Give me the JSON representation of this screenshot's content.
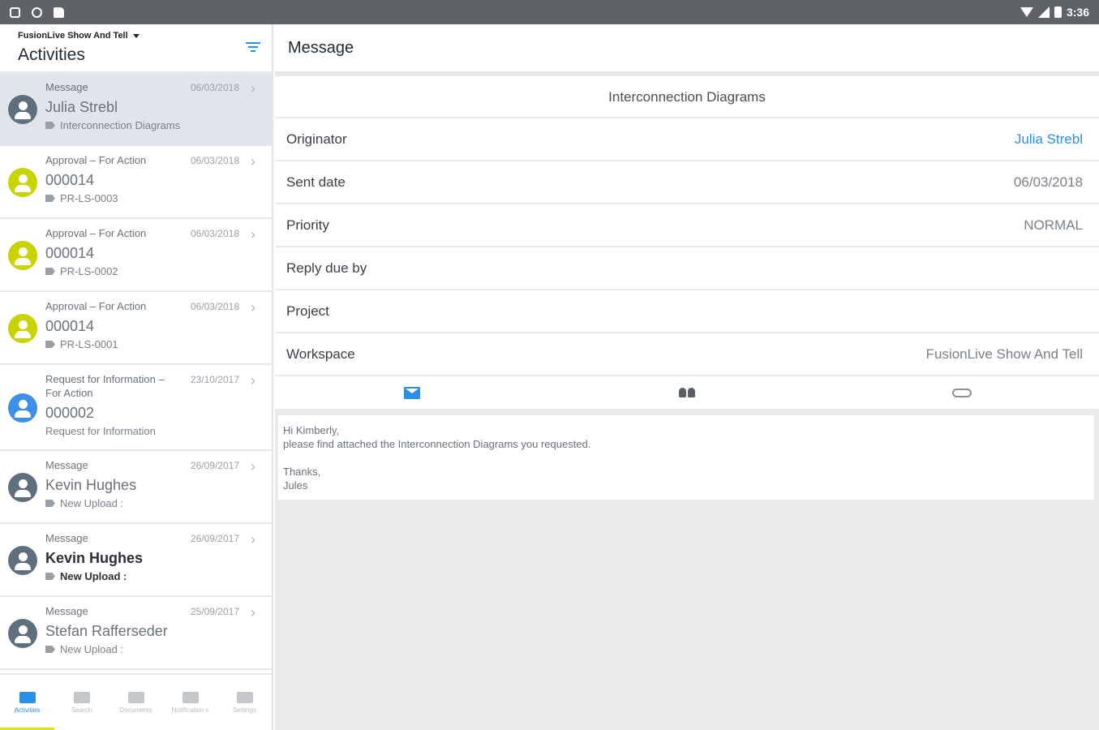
{
  "statusbar": {
    "time": "3:36"
  },
  "left": {
    "workspace": "FusionLive Show And Tell",
    "title": "Activities",
    "items": [
      {
        "type": "Message",
        "date": "06/03/2018",
        "title": "Julia Strebl",
        "sub": "Interconnection Diagrams",
        "avatar_color": "#5f6f7e",
        "selected": true,
        "bold": false
      },
      {
        "type": "Approval – For Action",
        "date": "06/03/2018",
        "title": "000014",
        "sub": "PR-LS-0003",
        "avatar_color": "#c8d400",
        "selected": false,
        "bold": false
      },
      {
        "type": "Approval – For Action",
        "date": "06/03/2018",
        "title": "000014",
        "sub": "PR-LS-0002",
        "avatar_color": "#c8d400",
        "selected": false,
        "bold": false
      },
      {
        "type": "Approval – For Action",
        "date": "06/03/2018",
        "title": "000014",
        "sub": "PR-LS-0001",
        "avatar_color": "#c8d400",
        "selected": false,
        "bold": false
      },
      {
        "type": "Request for Information – For Action",
        "date": "23/10/2017",
        "title": "000002",
        "sub": "Request for Information",
        "avatar_color": "#3d8fe8",
        "selected": false,
        "bold": false
      },
      {
        "type": "Message",
        "date": "26/09/2017",
        "title": "Kevin Hughes",
        "sub": "New Upload :",
        "avatar_color": "#5f6f7e",
        "selected": false,
        "bold": false
      },
      {
        "type": "Message",
        "date": "26/09/2017",
        "title": "Kevin Hughes",
        "sub": "New Upload :",
        "avatar_color": "#5f6f7e",
        "selected": false,
        "bold": true
      },
      {
        "type": "Message",
        "date": "25/09/2017",
        "title": "Stefan Rafferseder",
        "sub": "New Upload :",
        "avatar_color": "#5f6f7e",
        "selected": false,
        "bold": false
      }
    ],
    "nav": [
      {
        "label": "Activities",
        "icon": "mail-icon"
      },
      {
        "label": "Search",
        "icon": "search-icon"
      },
      {
        "label": "Documents",
        "icon": "documents-icon"
      },
      {
        "label": "Notification s",
        "icon": "bell-icon"
      },
      {
        "label": "Settings",
        "icon": "settings-icon"
      }
    ]
  },
  "right": {
    "title": "Message",
    "subject": "Interconnection Diagrams",
    "fields": [
      {
        "label": "Originator",
        "value": "Julia Strebl",
        "link": true
      },
      {
        "label": "Sent date",
        "value": "06/03/2018",
        "link": false
      },
      {
        "label": "Priority",
        "value": "NORMAL",
        "link": false
      },
      {
        "label": "Reply due by",
        "value": "",
        "link": false
      },
      {
        "label": "Project",
        "value": "",
        "link": false
      },
      {
        "label": "Workspace",
        "value": "FusionLive Show And Tell",
        "link": false
      }
    ],
    "body": {
      "line1": "Hi Kimberly,",
      "line2": "please find attached the Interconnection Diagrams you requested.",
      "line3": "Thanks,",
      "line4": "Jules"
    }
  }
}
